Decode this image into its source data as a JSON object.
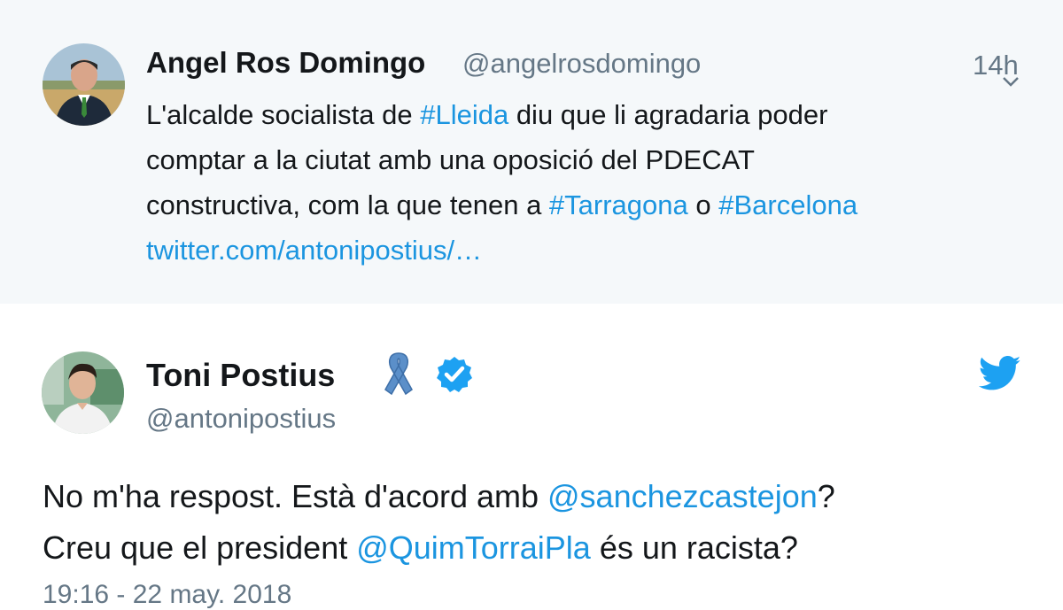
{
  "quoted_tweet": {
    "author_name": "Angel Ros Domingo",
    "handle": "@angelrosdomingo",
    "time": "14h",
    "text_lines": [
      [
        {
          "t": "L'alcalde socialista de "
        },
        {
          "t": "#Lleida",
          "link": true
        },
        {
          "t": " diu que li agradaria poder"
        }
      ],
      [
        {
          "t": "comptar a la ciutat amb una oposició del PDECAT"
        }
      ],
      [
        {
          "t": "constructiva, com la que tenen a "
        },
        {
          "t": "#Tarragona",
          "link": true
        },
        {
          "t": " o "
        },
        {
          "t": "#Barcelona",
          "link": true
        }
      ],
      [
        {
          "t": "twitter.com/antonipostius/…",
          "link": true
        }
      ]
    ],
    "avatar_icon": "profile-photo"
  },
  "main_tweet": {
    "author_name": "Toni Postius",
    "handle": "@antonipostius",
    "text_lines": [
      [
        {
          "t": "No m'ha respost. Està d'acord amb "
        },
        {
          "t": "@sanchezcastejon",
          "link": true
        },
        {
          "t": "?"
        }
      ],
      [
        {
          "t": "Creu que el president "
        },
        {
          "t": "@QuimTorraiPla",
          "link": true
        },
        {
          "t": " és un racista?"
        }
      ]
    ],
    "date": "19:16 - 22 may. 2018",
    "icons": [
      "ribbon-icon",
      "verified-icon",
      "twitter-bird-icon"
    ]
  },
  "colors": {
    "link": "#1b95e0",
    "muted": "#657786",
    "text": "#14171a",
    "quoted_bg": "#f5f8fa",
    "verified": "#1da1f2",
    "ribbon": "#5b8fc9"
  }
}
